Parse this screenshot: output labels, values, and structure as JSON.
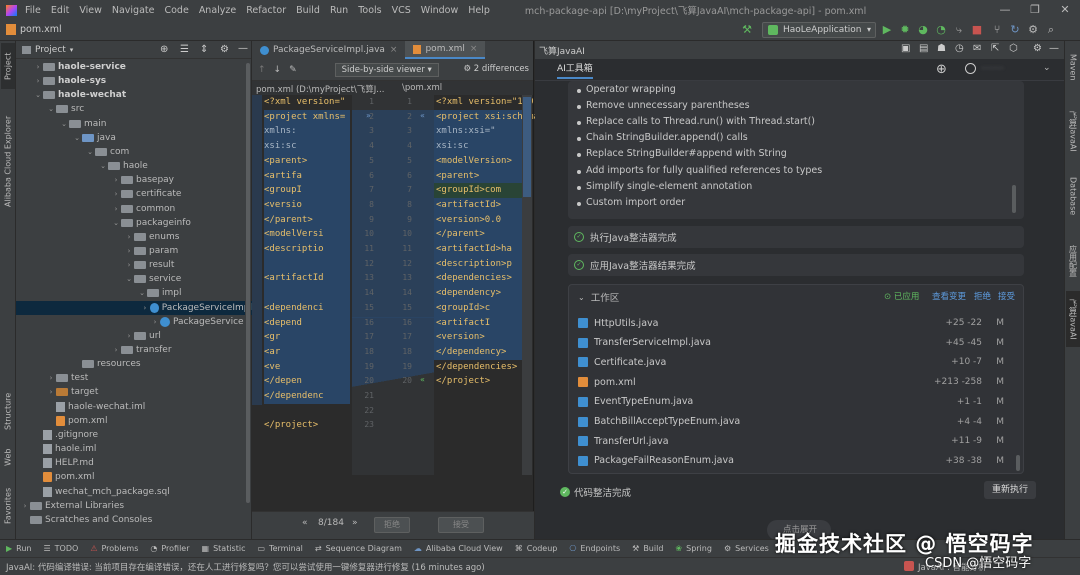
{
  "window": {
    "title": "mch-package-api [D:\\myProject\\飞算JavaAI\\mch-package-api] - pom.xml",
    "menu": [
      "File",
      "Edit",
      "View",
      "Navigate",
      "Code",
      "Analyze",
      "Refactor",
      "Build",
      "Run",
      "Tools",
      "VCS",
      "Window",
      "Help"
    ]
  },
  "navbar": {
    "breadcrumb": "pom.xml",
    "run_config": "HaoLeApplication"
  },
  "left_strip": [
    "Project",
    "Alibaba Cloud Explorer",
    "Structure",
    "Web",
    "Favorites"
  ],
  "right_strip": [
    "Maven",
    "飞算JavaAI",
    "Database",
    "应用配置",
    "飞算JavaAI"
  ],
  "project": {
    "header": "Project",
    "tree": [
      {
        "label": "haole-service",
        "depth": 1,
        "type": "folder",
        "bold": true,
        "arrow": "›"
      },
      {
        "label": "haole-sys",
        "depth": 1,
        "type": "folder",
        "bold": true,
        "arrow": "›"
      },
      {
        "label": "haole-wechat",
        "depth": 1,
        "type": "folder",
        "bold": true,
        "arrow": "⌄"
      },
      {
        "label": "src",
        "depth": 2,
        "type": "folder",
        "arrow": "⌄"
      },
      {
        "label": "main",
        "depth": 3,
        "type": "folder",
        "arrow": "⌄"
      },
      {
        "label": "java",
        "depth": 4,
        "type": "folder-blue",
        "arrow": "⌄"
      },
      {
        "label": "com",
        "depth": 5,
        "type": "folder",
        "arrow": "⌄"
      },
      {
        "label": "haole",
        "depth": 6,
        "type": "folder",
        "arrow": "⌄"
      },
      {
        "label": "basepay",
        "depth": 7,
        "type": "folder",
        "arrow": "›"
      },
      {
        "label": "certificate",
        "depth": 7,
        "type": "folder",
        "arrow": "›"
      },
      {
        "label": "common",
        "depth": 7,
        "type": "folder",
        "arrow": "›"
      },
      {
        "label": "packageinfo",
        "depth": 7,
        "type": "folder",
        "arrow": "⌄"
      },
      {
        "label": "enums",
        "depth": 8,
        "type": "folder",
        "arrow": "›"
      },
      {
        "label": "param",
        "depth": 8,
        "type": "folder",
        "arrow": "›"
      },
      {
        "label": "result",
        "depth": 8,
        "type": "folder",
        "arrow": "›"
      },
      {
        "label": "service",
        "depth": 8,
        "type": "folder",
        "arrow": "⌄"
      },
      {
        "label": "impl",
        "depth": 9,
        "type": "folder",
        "arrow": "⌄"
      },
      {
        "label": "PackageServiceImpl",
        "depth": 10,
        "type": "java",
        "arrow": "›",
        "selected": true
      },
      {
        "label": "PackageService",
        "depth": 10,
        "type": "java",
        "arrow": "›"
      },
      {
        "label": "url",
        "depth": 8,
        "type": "folder",
        "arrow": "›"
      },
      {
        "label": "transfer",
        "depth": 7,
        "type": "folder",
        "arrow": "›"
      },
      {
        "label": "resources",
        "depth": 4,
        "type": "folder",
        "arrow": ""
      },
      {
        "label": "test",
        "depth": 2,
        "type": "folder",
        "arrow": "›"
      },
      {
        "label": "target",
        "depth": 2,
        "type": "folder-orange",
        "arrow": "›"
      },
      {
        "label": "haole-wechat.iml",
        "depth": 2,
        "type": "txt",
        "arrow": ""
      },
      {
        "label": "pom.xml",
        "depth": 2,
        "type": "xml",
        "arrow": ""
      },
      {
        "label": ".gitignore",
        "depth": 1,
        "type": "txt",
        "arrow": ""
      },
      {
        "label": "haole.iml",
        "depth": 1,
        "type": "txt",
        "arrow": ""
      },
      {
        "label": "HELP.md",
        "depth": 1,
        "type": "txt",
        "arrow": ""
      },
      {
        "label": "pom.xml",
        "depth": 1,
        "type": "xml",
        "arrow": ""
      },
      {
        "label": "wechat_mch_package.sql",
        "depth": 1,
        "type": "txt",
        "arrow": ""
      },
      {
        "label": "External Libraries",
        "depth": 0,
        "type": "folder",
        "arrow": "›"
      },
      {
        "label": "Scratches and Consoles",
        "depth": 0,
        "type": "folder",
        "arrow": ""
      }
    ]
  },
  "editor": {
    "tabs": [
      "PackageServiceImpl.java",
      "pom.xml"
    ],
    "active_tab": 1,
    "viewer_mode": "Side-by-side viewer",
    "differences": "2 differences",
    "left_path": "pom.xml (D:\\myProject\\飞算J...",
    "right_path": "\\pom.xml",
    "left_code": [
      "<?xml version=\"",
      "<project xmlns=",
      "        xmlns:",
      "        xsi:sc",
      "    <parent>",
      "        <artifa",
      "        <groupI",
      "        <versio",
      "    </parent>",
      "    <modelVersi",
      "    <descriptio",
      "",
      "    <artifactId",
      "",
      "    <dependenci",
      "        <depend",
      "            <gr",
      "            <ar",
      "            <ve",
      "        </depen",
      "    </dependenc",
      "",
      "</project>"
    ],
    "left_nums": [
      "1",
      "2",
      "3",
      "4",
      "5",
      "6",
      "7",
      "8",
      "9",
      "10",
      "11",
      "12",
      "13",
      "14",
      "15",
      "16",
      "17",
      "18",
      "19",
      "20",
      "21",
      "22",
      "23"
    ],
    "right_nums": [
      "1",
      "2",
      "3",
      "4",
      "5",
      "6",
      "7",
      "8",
      "9",
      "10",
      "11",
      "12",
      "13",
      "14",
      "15",
      "16",
      "17",
      "18",
      "19",
      "20"
    ],
    "right_code": [
      "<?xml version=\"1.0\"",
      "<project xsi:schema",
      "    xmlns:xsi=\"",
      "    xsi:sc",
      "    <modelVersion>",
      "    <parent>",
      "        <groupId>com",
      "        <artifactId>",
      "        <version>0.0",
      "    </parent>",
      "    <artifactId>ha",
      "    <description>p",
      "    <dependencies>",
      "        <dependency>",
      "            <groupId>c",
      "            <artifactI",
      "            <version>",
      "        </dependency>",
      "    </dependencies>",
      "</project>"
    ],
    "page": "8/184",
    "reject": "拒绝",
    "accept": "接受"
  },
  "ai": {
    "header": "飞算JavaAI",
    "tab": "AI工具箱",
    "user_masked": "········",
    "bullets": [
      "Operator wrapping",
      "Remove unnecessary parentheses",
      "Replace calls to Thread.run() with Thread.start()",
      "Chain StringBuilder.append() calls",
      "Replace StringBuilder#append with String",
      "Add imports for fully qualified references to types",
      "Simplify single-element annotation",
      "Custom import order"
    ],
    "steps": [
      "执行Java整洁器完成",
      "应用Java整洁器结果完成"
    ],
    "workspace": {
      "title": "工作区",
      "applied": "已应用",
      "view_changes": "查看变更",
      "reject": "拒绝",
      "accept": "接受",
      "files": [
        {
          "name": "HttpUtils.java",
          "stat": "+25 -22",
          "mark": "M",
          "type": "java"
        },
        {
          "name": "TransferServiceImpl.java",
          "stat": "+45 -45",
          "mark": "M",
          "type": "java"
        },
        {
          "name": "Certificate.java",
          "stat": "+10 -7",
          "mark": "M",
          "type": "java"
        },
        {
          "name": "pom.xml",
          "stat": "+213 -258",
          "mark": "M",
          "type": "xml"
        },
        {
          "name": "EventTypeEnum.java",
          "stat": "+1 -1",
          "mark": "M",
          "type": "java"
        },
        {
          "name": "BatchBillAcceptTypeEnum.java",
          "stat": "+4 -4",
          "mark": "M",
          "type": "java"
        },
        {
          "name": "TransferUrl.java",
          "stat": "+11 -9",
          "mark": "M",
          "type": "java"
        },
        {
          "name": "PackageFailReasonEnum.java",
          "stat": "+38 -38",
          "mark": "M",
          "type": "java"
        }
      ]
    },
    "done": "代码整洁完成",
    "rerun": "重新执行",
    "expand": "点击展开"
  },
  "statusbar": {
    "tools": [
      "Run",
      "TODO",
      "Problems",
      "Profiler",
      "Statistic",
      "Terminal",
      "Sequence Diagram",
      "Alibaba Cloud View",
      "Codeup",
      "Endpoints",
      "Build",
      "Spring",
      "Services"
    ],
    "message": "JavaAI: 代码编译错误: 当前项目存在编译错误，还在人工进行修复吗？您可以尝试使用一键修复器进行修复 (16 minutes ago)",
    "right": "JavaAI : 智能分析"
  },
  "watermark": "掘金技术社区 @ 悟空码字",
  "watermark2": "CSDN @悟空码字",
  "colors": {
    "accent": "#4a88c7",
    "diff_blue": "#294566",
    "success": "#5fb85f",
    "link": "#5d9bde"
  }
}
